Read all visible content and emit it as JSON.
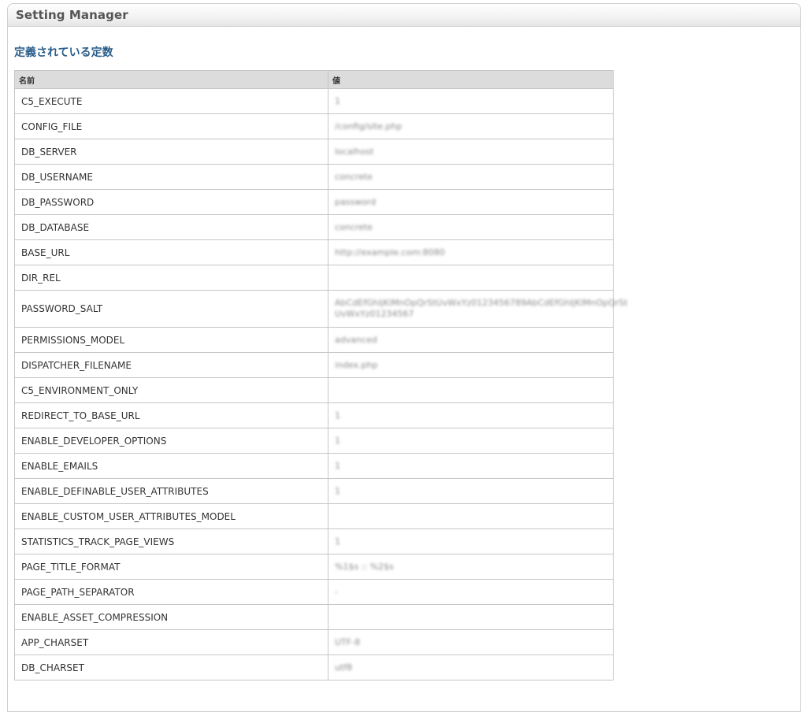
{
  "panel": {
    "title": "Setting Manager"
  },
  "section": {
    "title": "定義されている定数"
  },
  "table": {
    "headers": {
      "name": "名前",
      "value": "値"
    },
    "rows": [
      {
        "name": "C5_EXECUTE",
        "value": "1"
      },
      {
        "name": "CONFIG_FILE",
        "value": "/config/site.php"
      },
      {
        "name": "DB_SERVER",
        "value": "localhost"
      },
      {
        "name": "DB_USERNAME",
        "value": "concrete"
      },
      {
        "name": "DB_PASSWORD",
        "value": "password"
      },
      {
        "name": "DB_DATABASE",
        "value": "concrete"
      },
      {
        "name": "BASE_URL",
        "value": "http://example.com:8080"
      },
      {
        "name": "DIR_REL",
        "value": ""
      },
      {
        "name": "PASSWORD_SALT",
        "value": "AbCdEfGhIjKlMnOpQrStUvWxYz0123456789AbCdEfGhIjKlMnOpQrSt UvWxYz01234567"
      },
      {
        "name": "PERMISSIONS_MODEL",
        "value": "advanced"
      },
      {
        "name": "DISPATCHER_FILENAME",
        "value": "index.php"
      },
      {
        "name": "C5_ENVIRONMENT_ONLY",
        "value": ""
      },
      {
        "name": "REDIRECT_TO_BASE_URL",
        "value": "1"
      },
      {
        "name": "ENABLE_DEVELOPER_OPTIONS",
        "value": "1"
      },
      {
        "name": "ENABLE_EMAILS",
        "value": "1"
      },
      {
        "name": "ENABLE_DEFINABLE_USER_ATTRIBUTES",
        "value": "1"
      },
      {
        "name": "ENABLE_CUSTOM_USER_ATTRIBUTES_MODEL",
        "value": ""
      },
      {
        "name": "STATISTICS_TRACK_PAGE_VIEWS",
        "value": "1"
      },
      {
        "name": "PAGE_TITLE_FORMAT",
        "value": "%1$s :: %2$s"
      },
      {
        "name": "PAGE_PATH_SEPARATOR",
        "value": "-"
      },
      {
        "name": "ENABLE_ASSET_COMPRESSION",
        "value": ""
      },
      {
        "name": "APP_CHARSET",
        "value": "UTF-8"
      },
      {
        "name": "DB_CHARSET",
        "value": "utf8"
      }
    ]
  }
}
